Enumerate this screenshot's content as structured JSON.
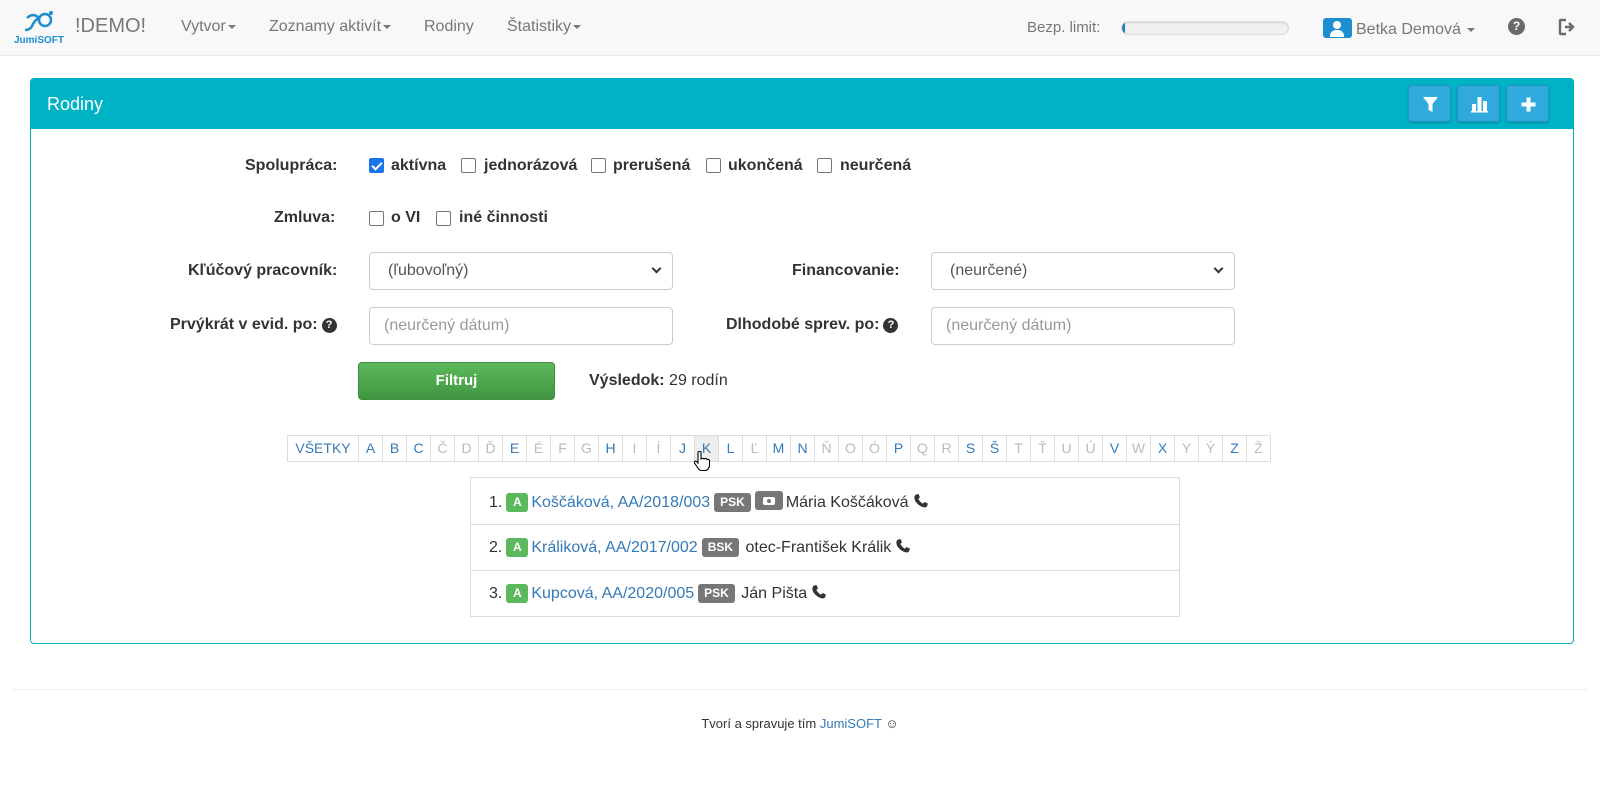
{
  "navbar": {
    "logo_text": "JumiSOFT",
    "brand": "!DEMO!",
    "menu": [
      {
        "label": "Vytvor",
        "dropdown": true
      },
      {
        "label": "Zoznamy aktivít",
        "dropdown": true
      },
      {
        "label": "Rodiny",
        "dropdown": false
      },
      {
        "label": "Štatistiky",
        "dropdown": true
      }
    ],
    "limit_label": "Bezp. limit:",
    "limit_fraction": 0.02,
    "user_name": "Betka Demová",
    "help_icon": "question-circle-icon",
    "logout_icon": "logout-icon"
  },
  "panel": {
    "title": "Rodiny",
    "buttons": [
      "filter-icon",
      "bar-chart-icon",
      "plus-icon"
    ]
  },
  "filters": {
    "spolupraca_label": "Spolupráca:",
    "spolupraca_options": [
      {
        "label": "aktívna",
        "checked": true
      },
      {
        "label": "jednorázová",
        "checked": false
      },
      {
        "label": "prerušená",
        "checked": false
      },
      {
        "label": "ukončená",
        "checked": false
      },
      {
        "label": "neurčená",
        "checked": false
      }
    ],
    "zmluva_label": "Zmluva:",
    "zmluva_options": [
      {
        "label": "o VI",
        "checked": false
      },
      {
        "label": "iné činnosti",
        "checked": false
      }
    ],
    "klucovy_label": "Kľúčový pracovník:",
    "klucovy_value": "(ľubovoľný)",
    "financovanie_label": "Financovanie:",
    "financovanie_value": "(neurčené)",
    "prvykrat_label": "Prvýkrát v evid. po:",
    "prvykrat_placeholder": "(neurčený dátum)",
    "dlhodobe_label": "Dlhodobé sprev. po:",
    "dlhodobe_placeholder": "(neurčený dátum)",
    "filter_button": "Filtruj",
    "result_label": "Výsledok:",
    "result_value": "29 rodín"
  },
  "alphabet": {
    "active": "K",
    "letters": [
      {
        "l": "VŠETKY",
        "on": true
      },
      {
        "l": "A",
        "on": true
      },
      {
        "l": "B",
        "on": true
      },
      {
        "l": "C",
        "on": true
      },
      {
        "l": "Č",
        "on": false
      },
      {
        "l": "D",
        "on": false
      },
      {
        "l": "Ď",
        "on": false
      },
      {
        "l": "E",
        "on": true
      },
      {
        "l": "É",
        "on": false
      },
      {
        "l": "F",
        "on": false
      },
      {
        "l": "G",
        "on": false
      },
      {
        "l": "H",
        "on": true
      },
      {
        "l": "I",
        "on": false
      },
      {
        "l": "Í",
        "on": false
      },
      {
        "l": "J",
        "on": true
      },
      {
        "l": "K",
        "on": true
      },
      {
        "l": "L",
        "on": true
      },
      {
        "l": "Ľ",
        "on": false
      },
      {
        "l": "M",
        "on": true
      },
      {
        "l": "N",
        "on": true
      },
      {
        "l": "Ň",
        "on": false
      },
      {
        "l": "O",
        "on": false
      },
      {
        "l": "Ó",
        "on": false
      },
      {
        "l": "P",
        "on": true
      },
      {
        "l": "Q",
        "on": false
      },
      {
        "l": "R",
        "on": false
      },
      {
        "l": "S",
        "on": true
      },
      {
        "l": "Š",
        "on": true
      },
      {
        "l": "T",
        "on": false
      },
      {
        "l": "Ť",
        "on": false
      },
      {
        "l": "U",
        "on": false
      },
      {
        "l": "Ú",
        "on": false
      },
      {
        "l": "V",
        "on": true
      },
      {
        "l": "W",
        "on": false
      },
      {
        "l": "X",
        "on": true
      },
      {
        "l": "Y",
        "on": false
      },
      {
        "l": "Ý",
        "on": false
      },
      {
        "l": "Z",
        "on": true
      },
      {
        "l": "Ž",
        "on": false
      }
    ]
  },
  "families": [
    {
      "num": "1.",
      "status": "A",
      "name": "Koščáková, AA/2018/003",
      "region": "PSK",
      "camera": true,
      "person": "Mária Koščáková"
    },
    {
      "num": "2.",
      "status": "A",
      "name": "Králiková, AA/2017/002",
      "region": "BSK",
      "camera": false,
      "person": "otec-František Králik"
    },
    {
      "num": "3.",
      "status": "A",
      "name": "Kupcová, AA/2020/005",
      "region": "PSK",
      "camera": false,
      "person": "Ján Pišta"
    }
  ],
  "footer": {
    "text": "Tvorí a spravuje tím",
    "link": "JumiSOFT",
    "smiley": "☺"
  }
}
